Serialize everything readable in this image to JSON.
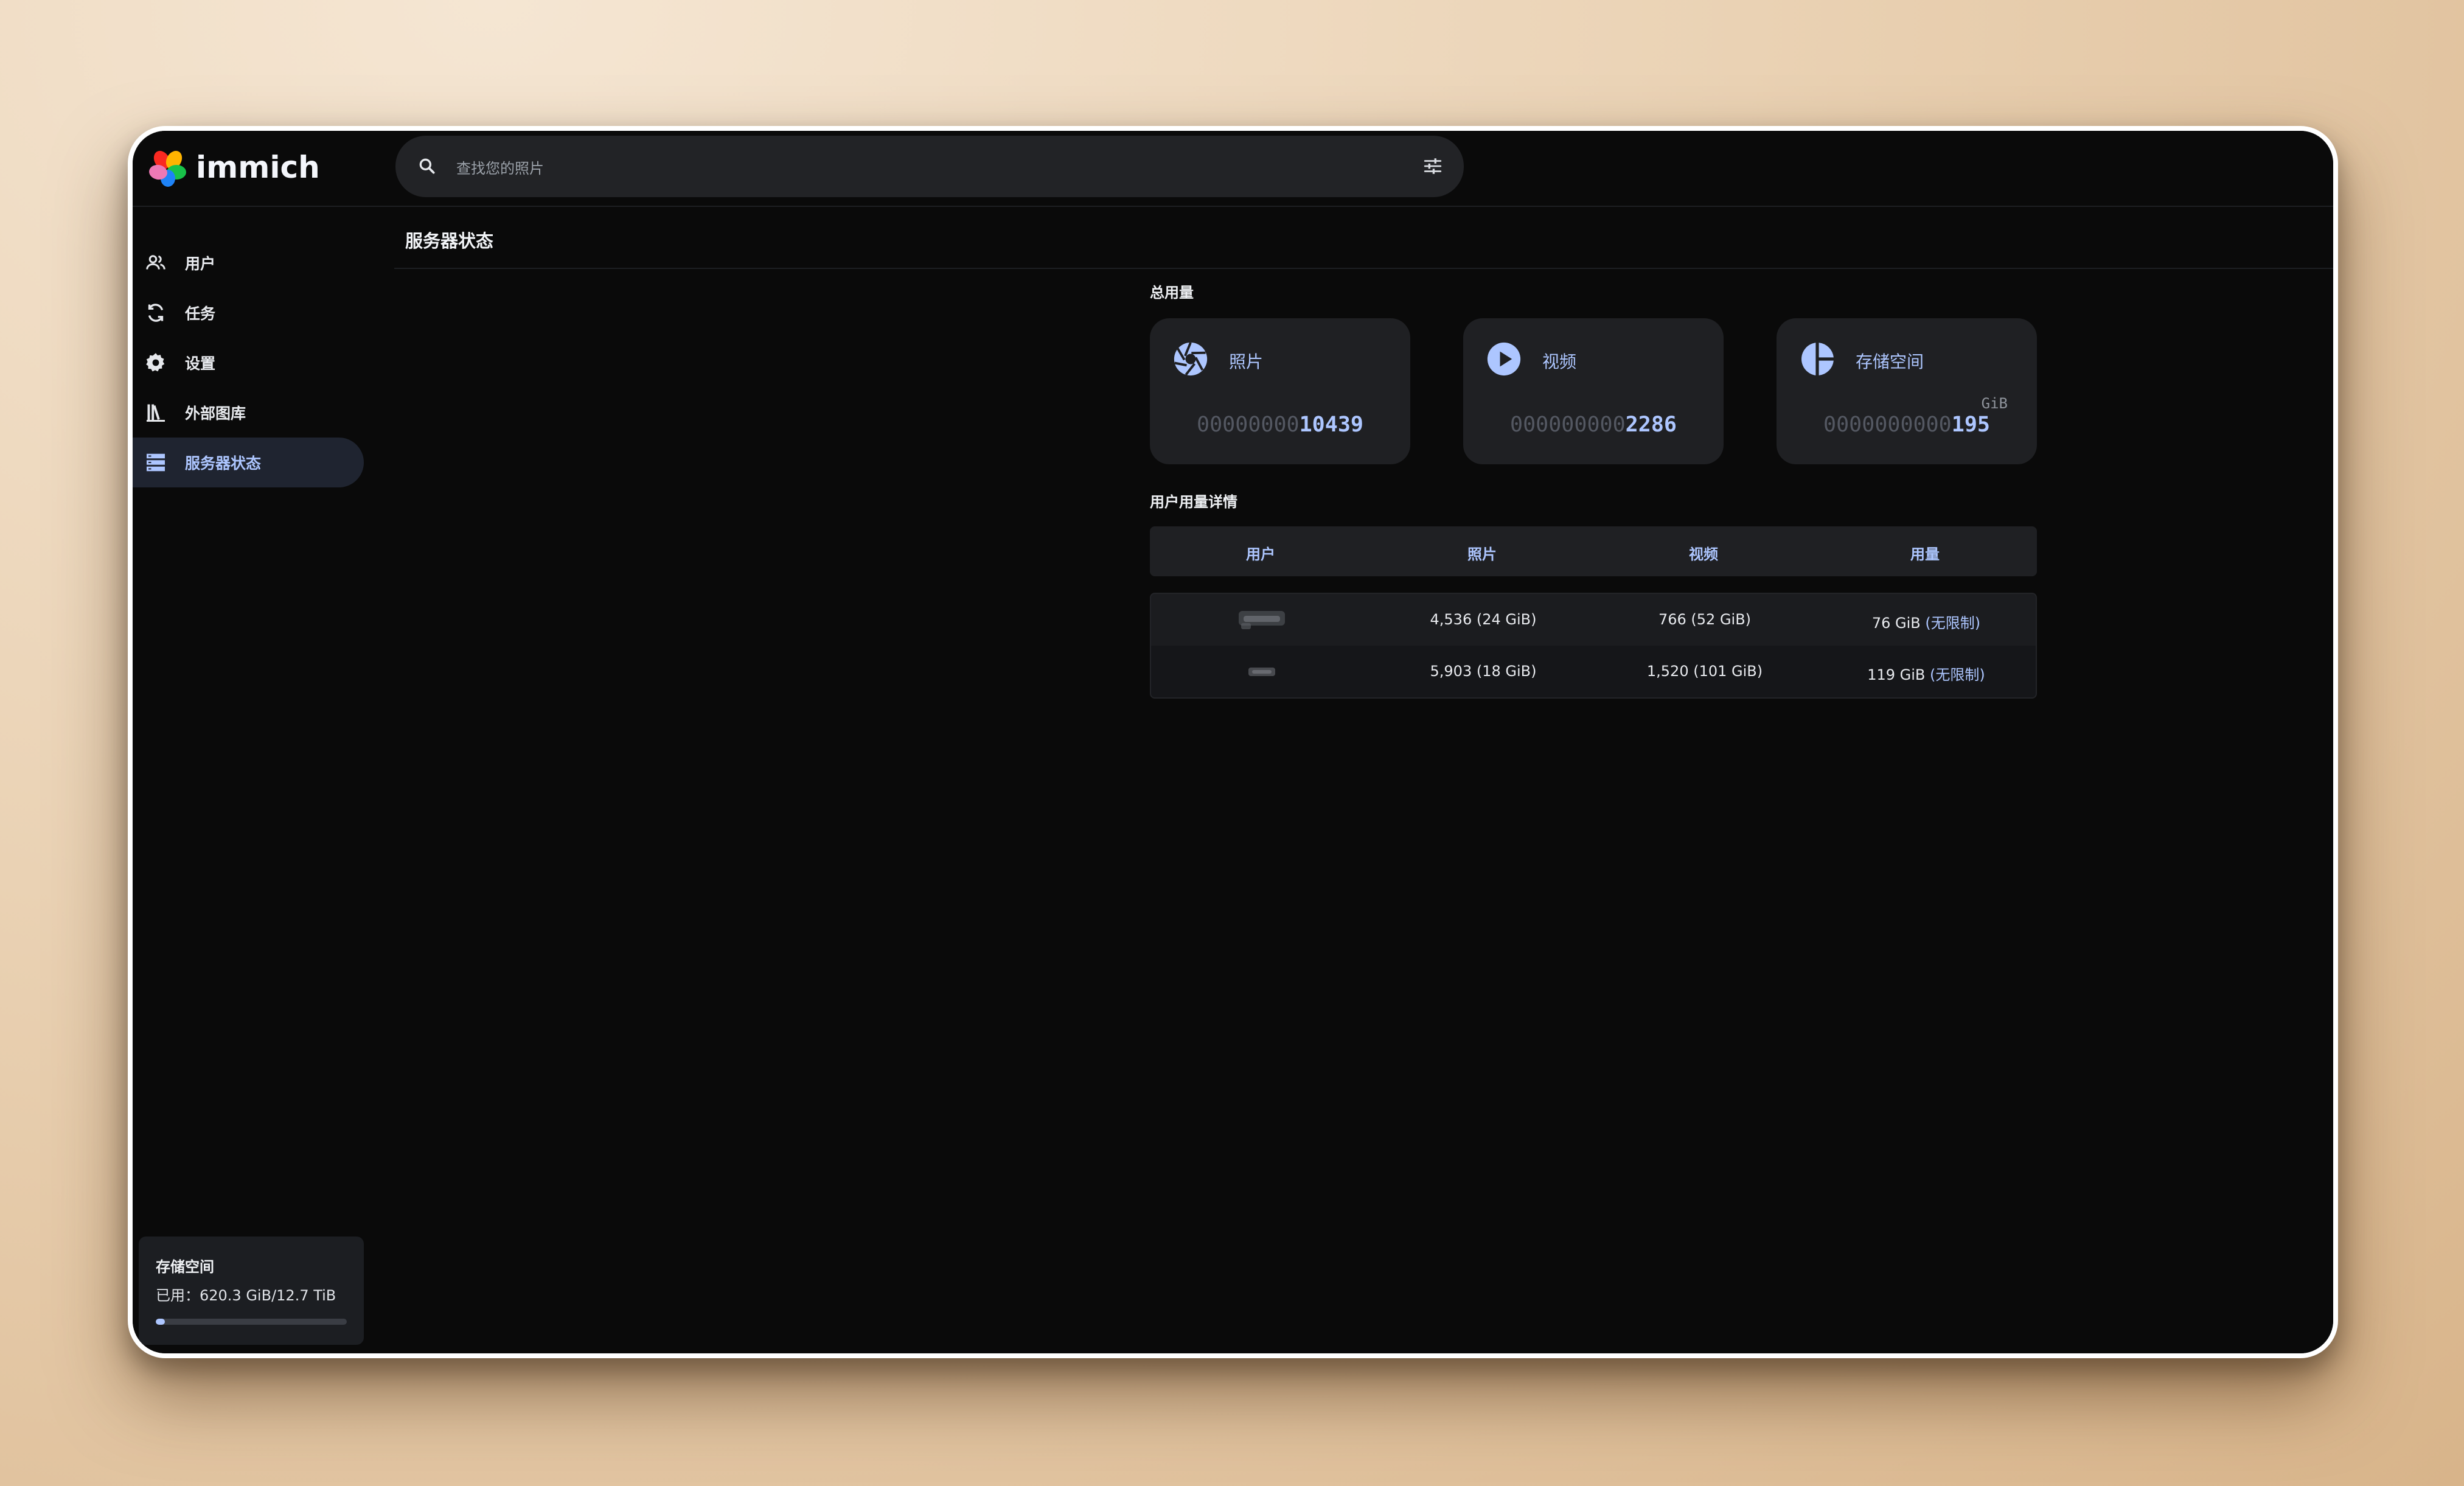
{
  "app": {
    "name": "immich"
  },
  "search": {
    "placeholder": "查找您的照片"
  },
  "sidebar": {
    "items": [
      {
        "label": "用户",
        "icon": "users-icon"
      },
      {
        "label": "任务",
        "icon": "sync-icon"
      },
      {
        "label": "设置",
        "icon": "gear-icon"
      },
      {
        "label": "外部图库",
        "icon": "library-icon"
      },
      {
        "label": "服务器状态",
        "icon": "server-icon",
        "active": true
      }
    ],
    "storage": {
      "title": "存储空间",
      "used": "已用：620.3 GiB/12.7 TiB",
      "used_fraction": 0.048
    }
  },
  "main": {
    "title": "服务器状态",
    "total_usage": {
      "label": "总用量",
      "cards": [
        {
          "label": "照片",
          "zeros": "00000000",
          "value": "10439",
          "unit": "",
          "icon": "aperture-icon"
        },
        {
          "label": "视频",
          "zeros": "000000000",
          "value": "2286",
          "unit": "",
          "icon": "play-icon"
        },
        {
          "label": "存储空间",
          "zeros": "0000000000",
          "value": "195",
          "unit": "GiB",
          "icon": "pie-chart-icon"
        }
      ]
    },
    "user_usage": {
      "label": "用户用量详情",
      "columns": [
        "用户",
        "照片",
        "视频",
        "用量"
      ],
      "rows": [
        {
          "photos": "4,536 (24 GiB)",
          "videos": "766 (52 GiB)",
          "usage": "76 GiB",
          "quota": "(无限制)"
        },
        {
          "photos": "5,903 (18 GiB)",
          "videos": "1,520 (101 GiB)",
          "usage": "119 GiB",
          "quota": "(无限制)"
        }
      ]
    }
  },
  "colors": {
    "accent": "#adc6ff",
    "background": "#0a0a0a",
    "card": "#1f2023"
  }
}
